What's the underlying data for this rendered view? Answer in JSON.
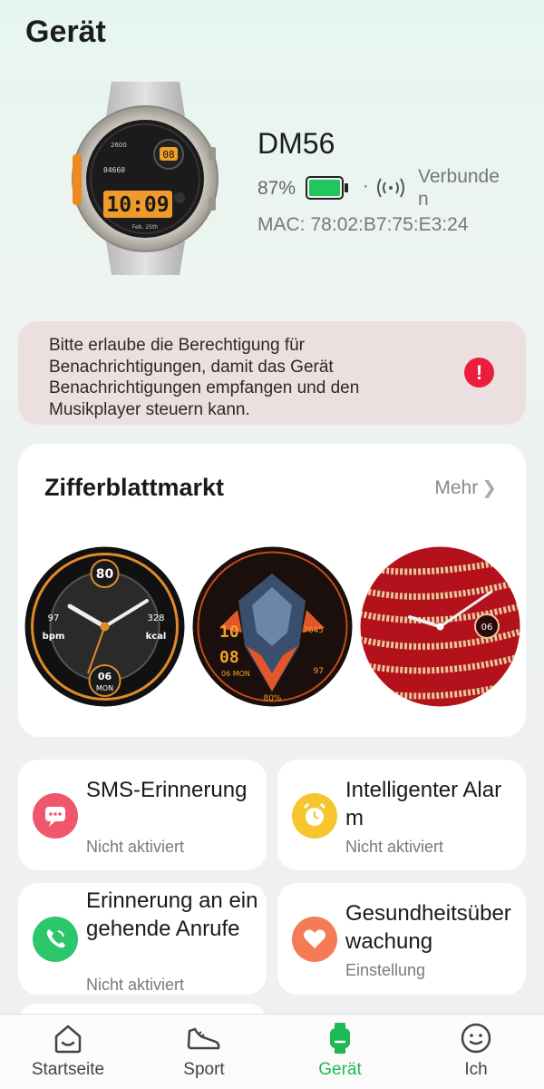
{
  "header": {
    "title": "Gerät"
  },
  "device": {
    "name": "DM56",
    "battery_percent": "87%",
    "battery_level": 0.87,
    "separator": "·",
    "connection_status": "Verbunden",
    "mac_label": "MAC:",
    "mac_address": "78:02:B7:75:E3:24",
    "image": {
      "icon": "smartwatch-image",
      "time": "10:09",
      "date": "Feb. 25th",
      "badge": "08",
      "step_value": "2600",
      "sub_value": "04660"
    }
  },
  "notice": {
    "text": "Bitte erlaube die Berechtigung für Benachrichtigungen, damit das Gerät Benachrichtigungen empfangen und den Musikplayer steuern kann.",
    "icon": "exclamation-icon",
    "icon_glyph": "!",
    "color": "#ea1d3c"
  },
  "market": {
    "title": "Zifferblattmarkt",
    "more_label": "Mehr",
    "faces": [
      {
        "name": "sport-face",
        "top_value": "80",
        "left_value": "97",
        "left_unit": "bpm",
        "right_value": "328",
        "right_unit": "kcal",
        "day": "06",
        "weekday": "MON"
      },
      {
        "name": "mecha-face",
        "hour": "10",
        "minute": "08",
        "date": "06 MON",
        "battery": "80%",
        "right_top": "7645",
        "right_bottom": "97"
      },
      {
        "name": "gold-chain-face",
        "day": "06"
      }
    ]
  },
  "features": [
    {
      "title": "SMS-Erinnerung",
      "subtitle": "Nicht aktiviert",
      "icon": "sms-icon",
      "color": "#f0566c"
    },
    {
      "title": "Intelligenter Alarm",
      "subtitle": "Nicht aktiviert",
      "icon": "alarm-clock-icon",
      "color": "#f7c52d"
    },
    {
      "title": "Erinnerung an eingehende Anrufe",
      "subtitle": "Nicht aktiviert",
      "icon": "phone-icon",
      "color": "#2dc76b"
    },
    {
      "title": "Gesundheitsüberwachung",
      "subtitle": "Einstellung",
      "icon": "heart-icon",
      "color": "#f47b56"
    }
  ],
  "nav": {
    "items": [
      {
        "label": "Startseite",
        "icon": "home-smile-icon"
      },
      {
        "label": "Sport",
        "icon": "sneaker-icon"
      },
      {
        "label": "Gerät",
        "icon": "watch-icon",
        "active": true
      },
      {
        "label": "Ich",
        "icon": "profile-smile-icon"
      }
    ],
    "active_color": "#1db954"
  }
}
